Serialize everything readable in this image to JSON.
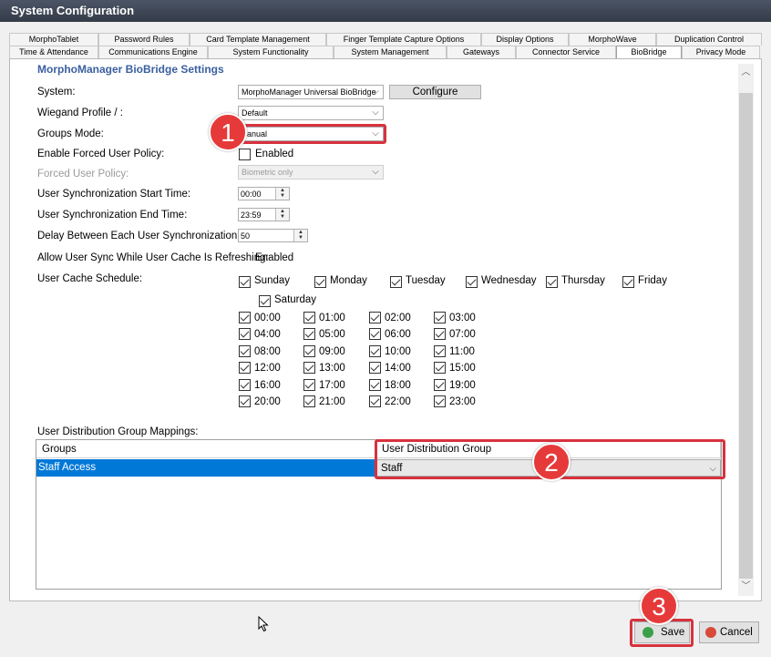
{
  "window": {
    "title": "System Configuration"
  },
  "tabs_row1": [
    "MorphoTablet",
    "Password Rules",
    "Card Template Management",
    "Finger Template Capture Options",
    "Display Options",
    "MorphoWave",
    "Duplication Control"
  ],
  "tabs_row2": [
    "Time & Attendance",
    "Communications Engine",
    "System Functionality",
    "System Management",
    "Gateways",
    "Connector Service",
    "BioBridge",
    "Privacy Mode"
  ],
  "active_tab": "BioBridge",
  "section_title": "MorphoManager BioBridge Settings",
  "form": {
    "system_label": "System:",
    "system_value": "MorphoManager Universal BioBridge",
    "configure_label": "Configure",
    "wiegand_label": "Wiegand Profile / :",
    "wiegand_value": "Default",
    "groups_mode_label": "Groups Mode:",
    "groups_mode_value": "anual",
    "forced_label": "Enable Forced User Policy:",
    "forced_enabled_label": "Enabled",
    "forced_policy_label": "Forced User Policy:",
    "forced_policy_value": "Biometric only",
    "sync_start_label": "User Synchronization Start Time:",
    "sync_start_value": "00:00",
    "sync_end_label": "User Synchronization End Time:",
    "sync_end_value": "23:59",
    "delay_label": "Delay Between Each User Synchronization (m",
    "delay_value": "50",
    "allow_label": "Allow User Sync While User Cache Is Refreshing:",
    "allow_value": "Enabled",
    "cache_label": "User Cache Schedule:"
  },
  "days": [
    "Sunday",
    "Monday",
    "Tuesday",
    "Wednesday",
    "Thursday",
    "Friday",
    "Saturday"
  ],
  "hours": [
    "00:00",
    "01:00",
    "02:00",
    "03:00",
    "04:00",
    "05:00",
    "06:00",
    "07:00",
    "08:00",
    "09:00",
    "10:00",
    "11:00",
    "12:00",
    "13:00",
    "14:00",
    "15:00",
    "16:00",
    "17:00",
    "18:00",
    "19:00",
    "20:00",
    "21:00",
    "22:00",
    "23:00"
  ],
  "mappings": {
    "label": "User Distribution Group Mappings:",
    "col_groups": "Groups",
    "col_udg": "User Distribution Group",
    "row_group": "Staff Access",
    "row_udg": "Staff"
  },
  "footer": {
    "save_label": "Save",
    "cancel_label": "Cancel"
  },
  "callouts": [
    "1",
    "2",
    "3"
  ],
  "colors": {
    "accent": "#0078d7",
    "callout": "#e63a3a",
    "title_blue": "#3a5fa0"
  }
}
